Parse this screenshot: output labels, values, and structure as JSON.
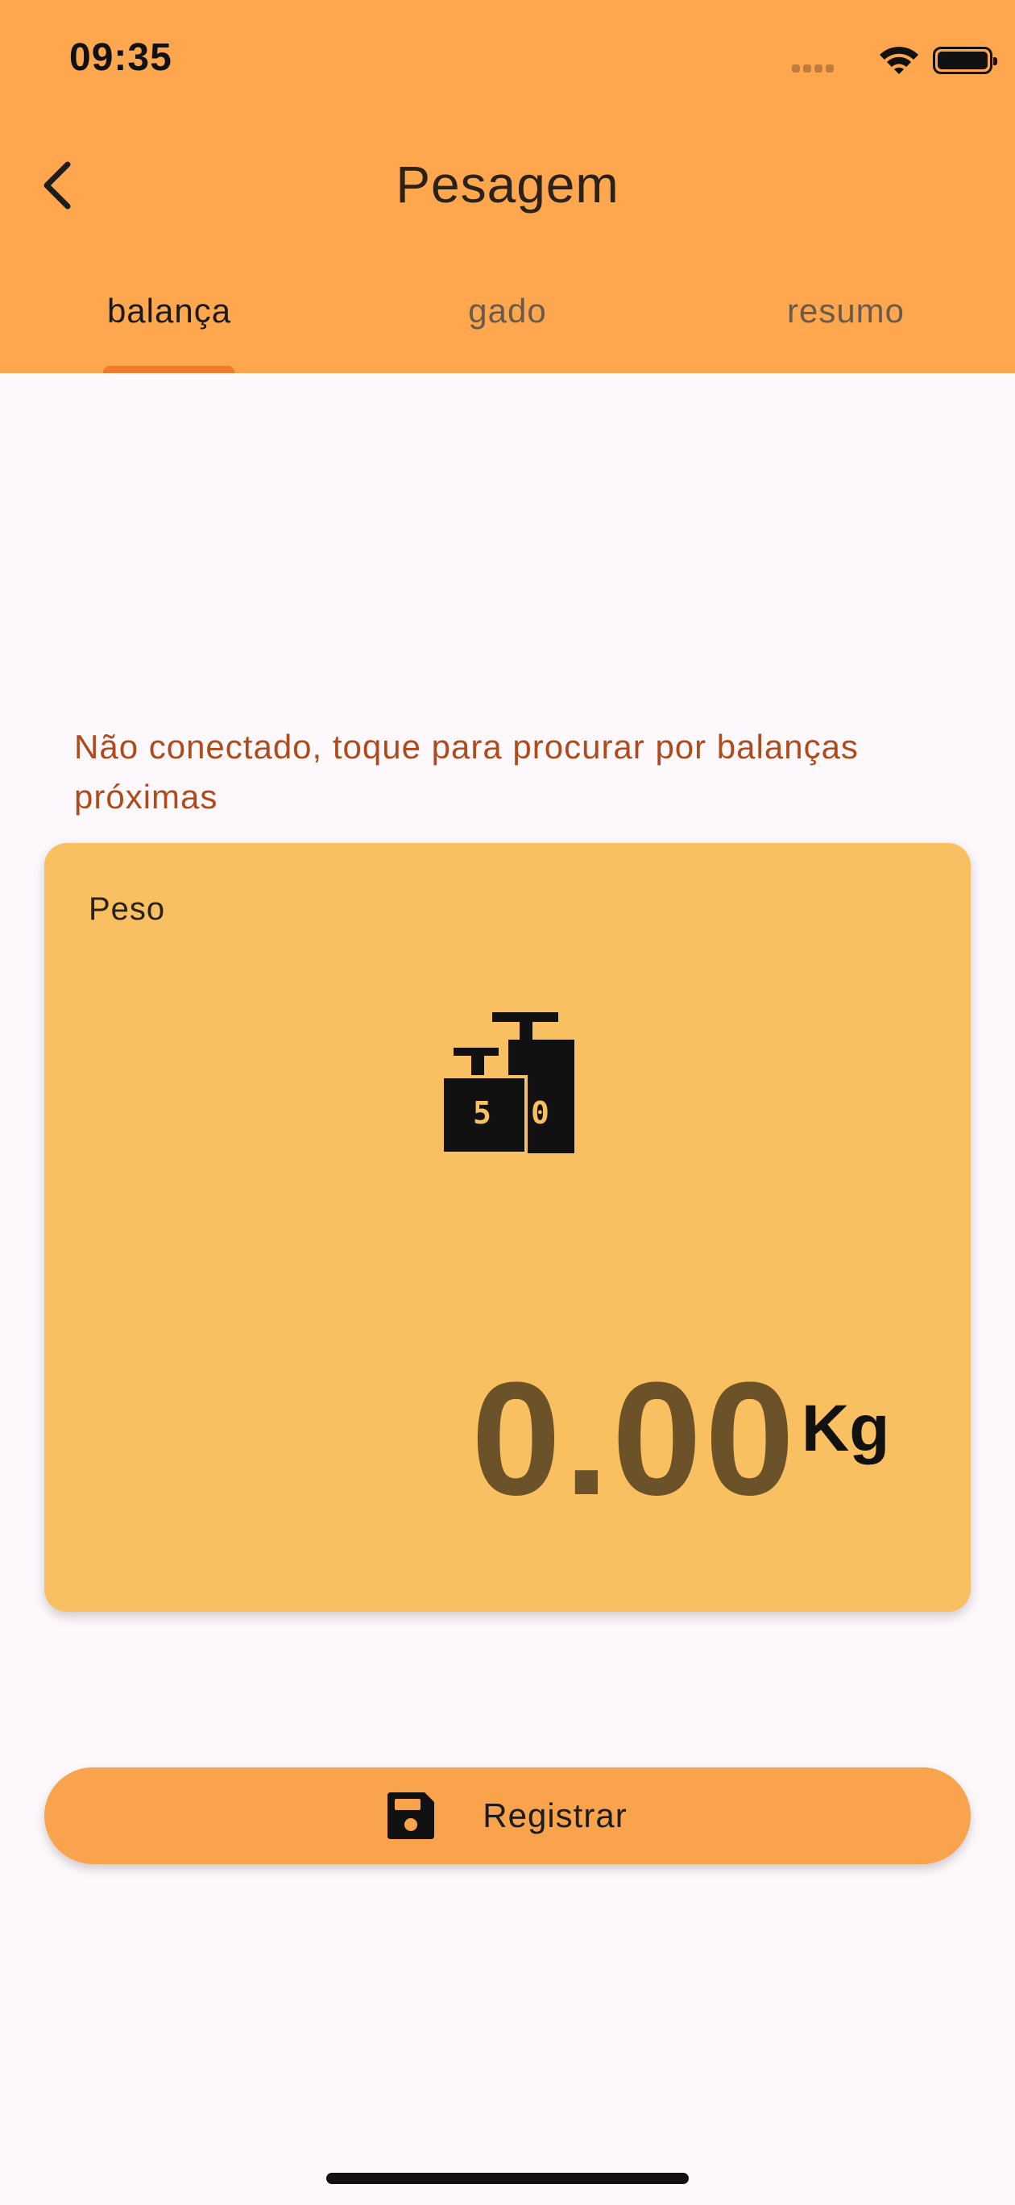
{
  "status_bar": {
    "time": "09:35",
    "icons": [
      "signal-icon",
      "wifi-icon",
      "battery-icon"
    ]
  },
  "header": {
    "title": "Pesagem",
    "back_icon": "chevron-left-icon",
    "background_color": "#fea74e"
  },
  "tabs": [
    {
      "label": "balança",
      "active": true
    },
    {
      "label": "gado",
      "active": false
    },
    {
      "label": "resumo",
      "active": false
    }
  ],
  "main": {
    "connection_warning": "Não conectado, toque para procurar por balanças próximas",
    "weight_card": {
      "label": "Peso",
      "icon": "weights-icon",
      "value": "0.00",
      "unit": "Kg",
      "background_color": "#f8c061"
    },
    "register_button": {
      "label": "Registrar",
      "icon": "save-icon",
      "color": "#f9a34d"
    }
  }
}
